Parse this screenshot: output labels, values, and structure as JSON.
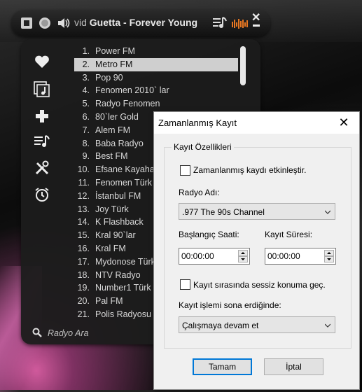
{
  "player": {
    "title_prefix": "vid",
    "now_playing": "Guetta - Forever Young"
  },
  "stations": [
    {
      "num": "1.",
      "name": "Power FM"
    },
    {
      "num": "2.",
      "name": "Metro FM"
    },
    {
      "num": "3.",
      "name": "Pop 90"
    },
    {
      "num": "4.",
      "name": "Fenomen 2010` lar"
    },
    {
      "num": "5.",
      "name": "Radyo Fenomen"
    },
    {
      "num": "6.",
      "name": "80`ler Gold"
    },
    {
      "num": "7.",
      "name": "Alem FM"
    },
    {
      "num": "8.",
      "name": "Baba Radyo"
    },
    {
      "num": "9.",
      "name": "Best FM"
    },
    {
      "num": "10.",
      "name": "Efsane Kayahan"
    },
    {
      "num": "11.",
      "name": "Fenomen Türk"
    },
    {
      "num": "12.",
      "name": "İstanbul FM"
    },
    {
      "num": "13.",
      "name": "Joy Türk"
    },
    {
      "num": "14.",
      "name": "K Flashback"
    },
    {
      "num": "15.",
      "name": "Kral 90`lar"
    },
    {
      "num": "16.",
      "name": "Kral FM"
    },
    {
      "num": "17.",
      "name": "Mydonose Türk"
    },
    {
      "num": "18.",
      "name": "NTV Radyo"
    },
    {
      "num": "19.",
      "name": "Number1 Türk"
    },
    {
      "num": "20.",
      "name": "Pal FM"
    },
    {
      "num": "21.",
      "name": "Polis Radyosu"
    }
  ],
  "selected_index": 1,
  "search": {
    "placeholder": "Radyo Ara"
  },
  "dialog": {
    "title": "Zamanlanmış Kayıt",
    "close": "✕",
    "group_label": "Kayıt Özellikleri",
    "enable_label": "Zamanlanmış kaydı etkinleştir.",
    "enable_checked": false,
    "radio_label": "Radyo Adı:",
    "radio_value": ".977 The 90s Channel",
    "start_label": "Başlangıç Saati:",
    "start_value": "00:00:00",
    "duration_label": "Kayıt Süresi:",
    "duration_value": "00:00:00",
    "mute_label": "Kayıt sırasında sessiz konuma geç.",
    "mute_checked": false,
    "after_label": "Kayıt işlemi sona erdiğinde:",
    "after_value": "Çalışmaya devam et",
    "ok": "Tamam",
    "cancel": "İptal"
  }
}
